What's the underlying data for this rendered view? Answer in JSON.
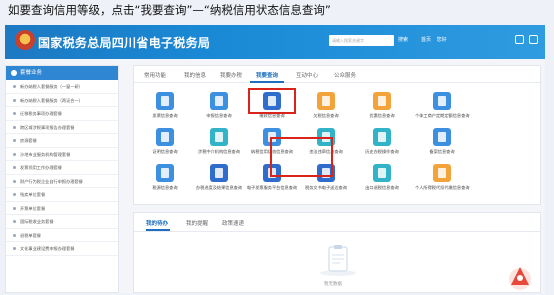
{
  "caption": "如要查询信用等级，点击“我要查询”—“纳税信用状态信息查询”",
  "header": {
    "site_title": "国家税务总局四川省电子税务局",
    "search_placeholder": "请输入搜索关键字",
    "search_button": "搜索",
    "user_links": [
      "首页",
      "您好"
    ]
  },
  "sidebar": {
    "title": "套餐业务",
    "items": [
      "新办纳税人套餐服务（一窗一研）",
      "新办纳税人套餐服务（两证合一）",
      "迁移税务事项办理套餐",
      "跨区域涉税事项报告办理套餐",
      "房源套餐",
      "沙地市业服务机构管理套餐",
      "发票领用工作办理套餐",
      "财产行为税企业自行申报办理套餐",
      "残疾单位套餐",
      "开票单位套餐",
      "国际税收业务套餐",
      "退税单套餐",
      "文化事业建设费申报办理套餐"
    ]
  },
  "main_tabs": [
    "常用功能",
    "我的信息",
    "我要办税",
    "我要查询",
    "互动中心",
    "公众服务"
  ],
  "query_items": [
    [
      "发票信息查询",
      "申报信息查询",
      "缴款信息查询",
      "欠税信息查询",
      "优惠信息查询",
      "个体工商户定期定额信息查询"
    ],
    [
      "证明信息查询",
      "涉税中介机构信息查询",
      "纳税信用状态信息查询",
      "违法违章信息查询",
      "历史办税操作查询",
      "备案信息查询"
    ],
    [
      "税源信息查询",
      "办税进度及结果信息查询",
      "电子发票服务平台信息查询",
      "税务文书电子送达查询",
      "出口退税信息查询",
      "个人所得税代扣代缴信息查询"
    ]
  ],
  "bottom_tabs": [
    "我的待办",
    "我的提醒",
    "政策速递"
  ],
  "empty_text": "暂无数据",
  "colors": {
    "header": "#1a8ad6",
    "accent": "#1f6fc0",
    "highlight": "#d9241b"
  }
}
